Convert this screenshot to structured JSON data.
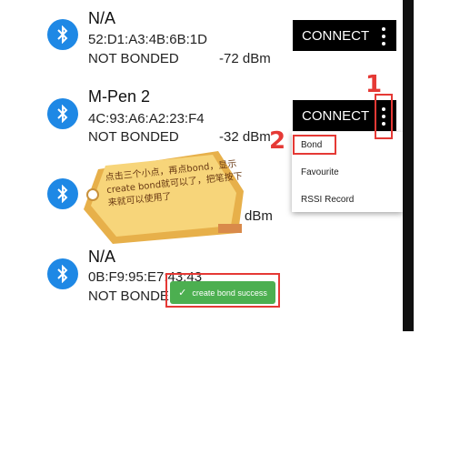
{
  "devices": [
    {
      "name": "N/A",
      "mac": "52:D1:A3:4B:6B:1D",
      "bond_state": "NOT BONDED",
      "rssi": "-72 dBm",
      "action": "CONNECT"
    },
    {
      "name": "M-Pen 2",
      "mac": "4C:93:A6:A2:23:F4",
      "bond_state": "NOT BONDED",
      "rssi": "-32 dBm",
      "action": "CONNECT"
    },
    {
      "rssi": "dBm"
    },
    {
      "name": "N/A",
      "mac": "0B:F9:95:E7:43:43",
      "bond_state": "NOT BONDED"
    }
  ],
  "menu": {
    "items": [
      "Bond",
      "Favourite",
      "RSSI Record"
    ]
  },
  "toast": {
    "text": "create bond success"
  },
  "annotations": {
    "step1": "1",
    "step2": "2",
    "note": "点击三个小点，再点bond，显示create bond就可以了，把笔按下来就可以使用了"
  },
  "colors": {
    "bluetooth": "#1e88e5",
    "toast": "#4caf50",
    "annotation": "#e53935",
    "tag": "#f4c542"
  },
  "icons": {
    "bluetooth": "bluetooth-icon",
    "more": "more-vert-icon",
    "check": "check-icon"
  }
}
